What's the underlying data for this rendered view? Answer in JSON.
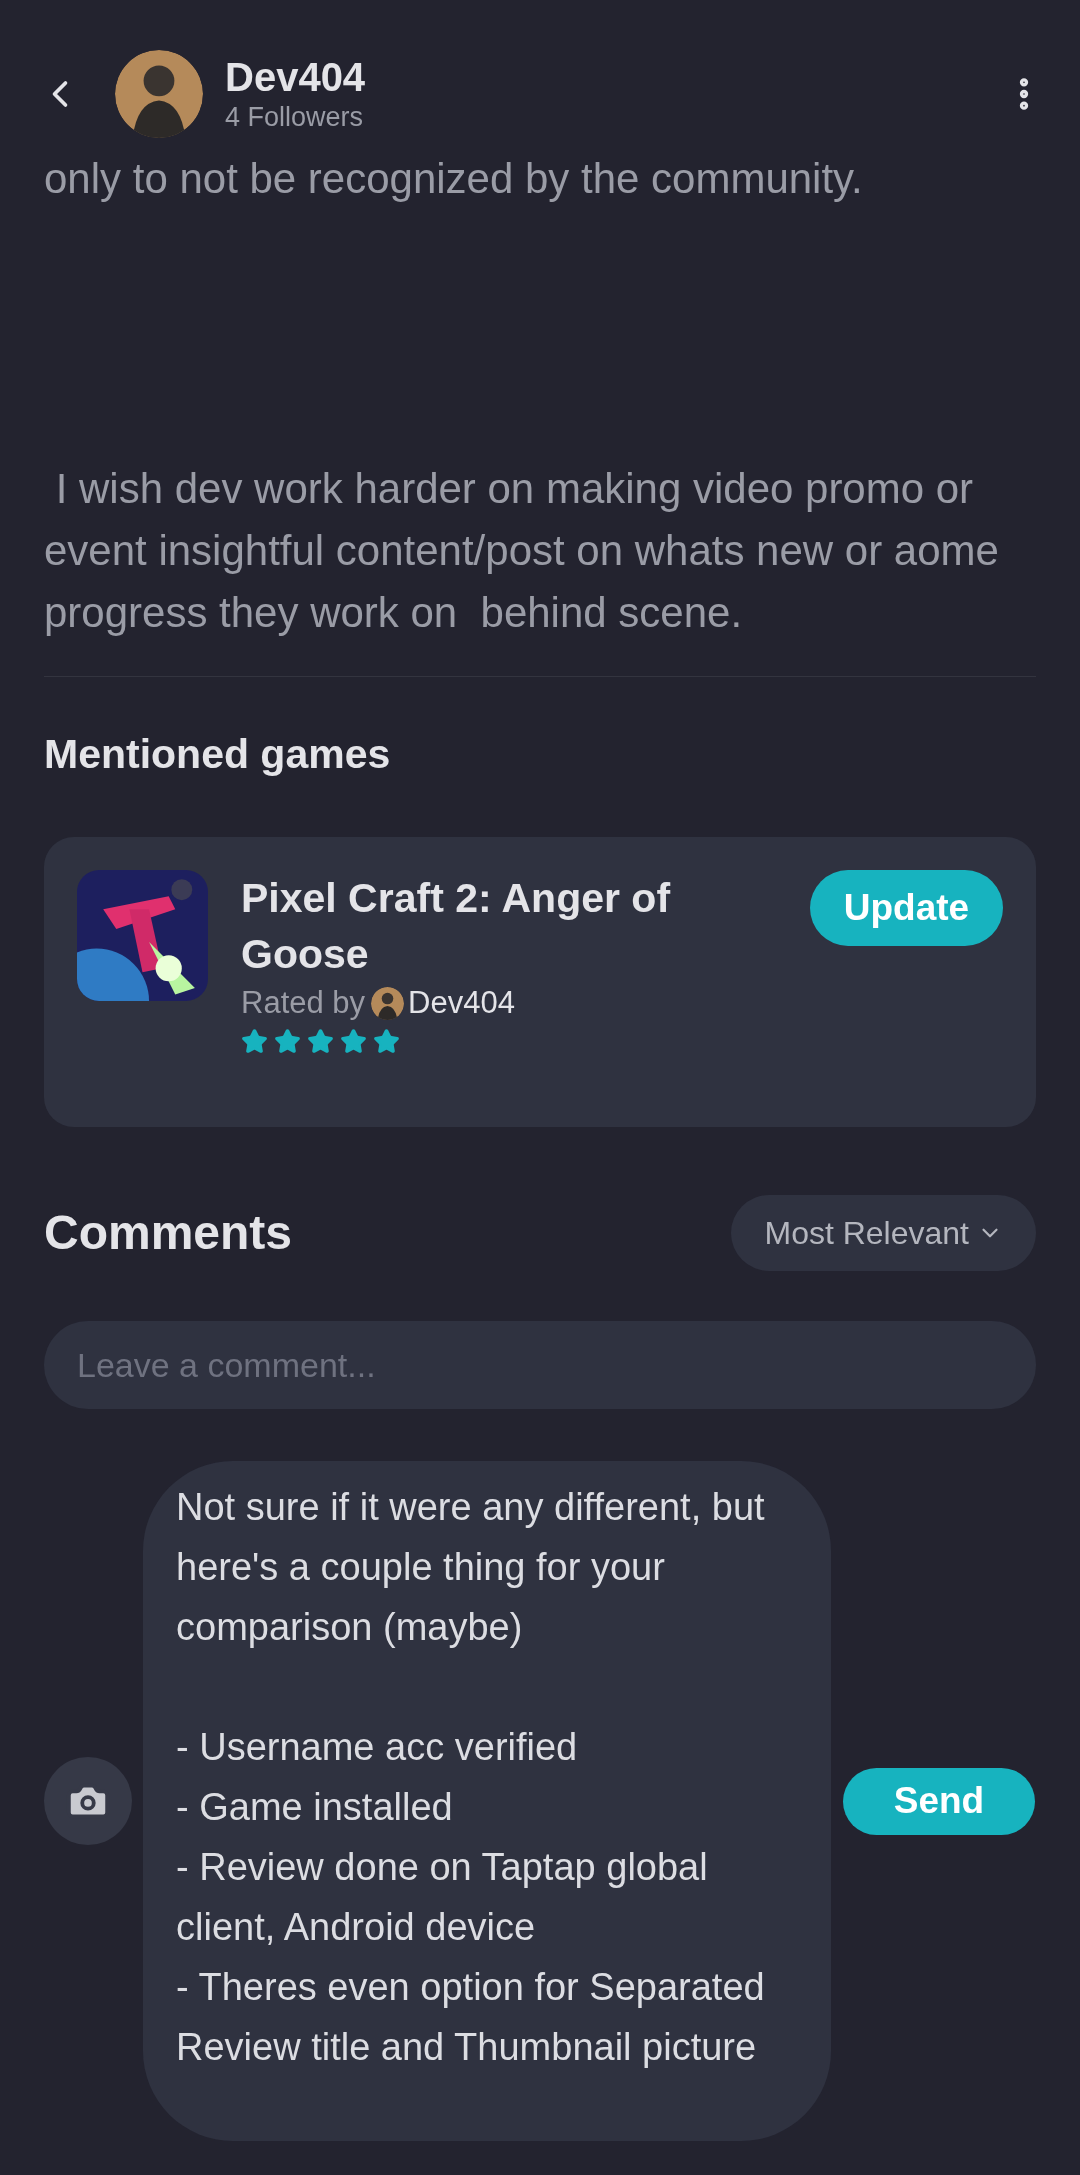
{
  "header": {
    "username": "Dev404",
    "followers": "4 Followers"
  },
  "post": {
    "paragraphs": [
      "only to not be recognized by the community.",
      " I wish dev work harder on making video promo or event insightful content/post on whats new or aome progress they work on  behind scene."
    ]
  },
  "mentioned_games": {
    "title": "Mentioned games",
    "games": [
      {
        "name": "Pixel Craft 2: Anger of Goose",
        "rated_by_label": "Rated by",
        "rater": "Dev404",
        "stars": 5,
        "button": "Update"
      }
    ]
  },
  "comments": {
    "title": "Comments",
    "sort": "Most Relevant",
    "placeholder": "Leave a comment...",
    "draft": "Not sure if it were any different, but here's a couple thing for your comparison (maybe)\n\n- Username acc verified\n- Game installed\n- Review done on Taptap global client, Android device\n- Theres even option for Separated Review title and Thumbnail picture",
    "send": "Send"
  }
}
